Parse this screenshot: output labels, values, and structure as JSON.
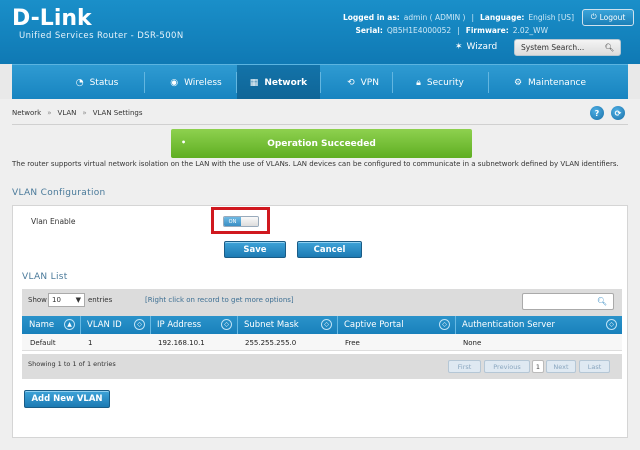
{
  "header": {
    "brand": "D-Link",
    "subtitle": "Unified Services Router - DSR-500N",
    "logged_in_label": "Logged in as:",
    "logged_in_value": "admin ( ADMIN )",
    "language_label": "Language:",
    "language_value": "English [US]",
    "logout_label": "Logout",
    "serial_label": "Serial:",
    "serial_value": "QB5H1E4000052",
    "firmware_label": "Firmware:",
    "firmware_value": "2.02_WW",
    "wizard_label": "Wizard",
    "search_placeholder": "System Search..."
  },
  "nav": {
    "items": [
      {
        "label": "Status",
        "icon": "gauge-icon"
      },
      {
        "label": "Wireless",
        "icon": "wifi-icon"
      },
      {
        "label": "Network",
        "icon": "network-icon",
        "active": true
      },
      {
        "label": "VPN",
        "icon": "vpn-icon"
      },
      {
        "label": "Security",
        "icon": "lock-icon"
      },
      {
        "label": "Maintenance",
        "icon": "gears-icon"
      }
    ]
  },
  "breadcrumb": [
    "Network",
    "VLAN",
    "VLAN Settings"
  ],
  "breadcrumb_sep": "»",
  "message": "Operation Succeeded",
  "description": "The router supports virtual network isolation on the LAN with the use of VLANs. LAN devices can be configured to communicate in a subnetwork defined by VLAN identifiers.",
  "vlan_config": {
    "title": "VLAN Configuration",
    "enable_label": "Vlan Enable",
    "toggle_text": "ON",
    "save_label": "Save",
    "cancel_label": "Cancel"
  },
  "vlan_list": {
    "title": "VLAN List",
    "show_label": "Show",
    "page_size": "10",
    "entries_label": "entries",
    "hint": "[Right click on record to get more options]",
    "columns": [
      "Name",
      "VLAN ID",
      "IP Address",
      "Subnet Mask",
      "Captive Portal",
      "Authentication Server"
    ],
    "rows": [
      [
        "Default",
        "1",
        "192.168.10.1",
        "255.255.255.0",
        "Free",
        "None"
      ]
    ],
    "showing": "Showing 1 to 1 of 1 entries",
    "pagination": {
      "first": "First",
      "previous": "Previous",
      "current": "1",
      "next": "Next",
      "last": "Last"
    },
    "add_label": "Add New VLAN"
  },
  "colors": {
    "brand_blue": "#1784c0",
    "success_green": "#6fbf2c",
    "highlight_red": "#d0181f"
  }
}
